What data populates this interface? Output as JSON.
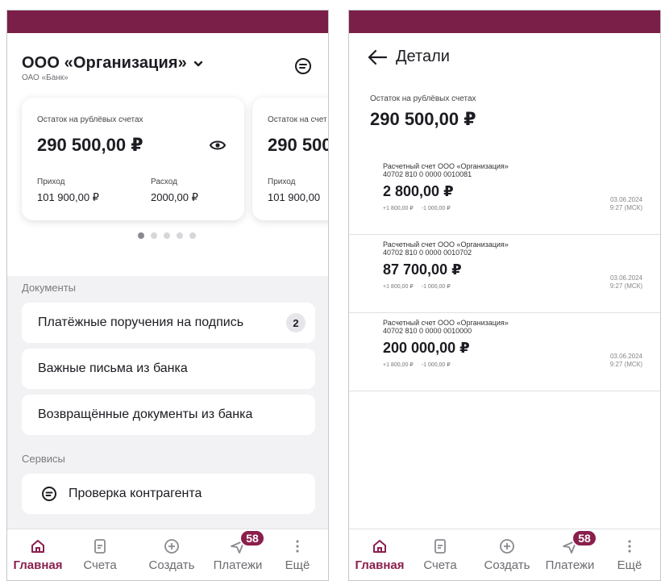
{
  "colors": {
    "brand": "#7a1f47",
    "accent": "#8a1f4d",
    "badge_bg": "#e6e6ea"
  },
  "home": {
    "org_name": "ООО «Организация»",
    "bank_name": "ОАО «Банк»",
    "cards": [
      {
        "label": "Остаток на рублёвых счетах",
        "balance": "290 500,00 ₽",
        "income_label": "Приход",
        "income": "101 900,00 ₽",
        "expense_label": "Расход",
        "expense": "2000,00 ₽"
      },
      {
        "label": "Остаток на счет",
        "balance": "290 500",
        "income_label": "Приход",
        "income": "101 900,00"
      }
    ],
    "pager": {
      "count": 5,
      "active": 0
    },
    "documents_label": "Документы",
    "documents": [
      {
        "label": "Платёжные поручения на подпись",
        "count": "2"
      },
      {
        "label": "Важные письма из банка"
      },
      {
        "label": "Возвращённые документы из банка"
      }
    ],
    "services_label": "Сервисы",
    "services": [
      {
        "label": "Проверка контрагента",
        "icon": "chat-check-icon"
      }
    ]
  },
  "tabbar": {
    "tabs": [
      {
        "label": "Главная",
        "icon": "home-icon",
        "active": true
      },
      {
        "label": "Счета",
        "icon": "document-icon"
      },
      {
        "label": "Создать",
        "icon": "plus-circle-icon"
      },
      {
        "label": "Платежи",
        "icon": "send-icon",
        "badge": "58"
      },
      {
        "label": "Ещё",
        "icon": "more-vertical-icon"
      }
    ]
  },
  "details": {
    "title": "Детали",
    "balance_label": "Остаток на рублёвых счетах",
    "balance": "290 500,00 ₽",
    "accounts": [
      {
        "name": "Расчетный счет ООО «Организация»",
        "number": "40702 810 0 0000 0010081",
        "amount": "2 800,00 ₽",
        "plus": "+1 800,00 ₽",
        "minus": "-1 000,00 ₽",
        "date": "03.06.2024",
        "time": "9:27 (МСК)"
      },
      {
        "name": "Расчетный счет ООО «Организация»",
        "number": "40702 810 0 0000 0010702",
        "amount": "87 700,00 ₽",
        "plus": "+1 800,00 ₽",
        "minus": "-1 000,00 ₽",
        "date": "03.06.2024",
        "time": "9:27 (МСК)"
      },
      {
        "name": "Расчетный счет ООО «Организация»",
        "number": "40702 810 0 0000 0010000",
        "amount": "200 000,00 ₽",
        "plus": "+1 800,00 ₽",
        "minus": "-1 000,00 ₽",
        "date": "03.06.2024",
        "time": "9:27 (МСК)"
      }
    ]
  }
}
